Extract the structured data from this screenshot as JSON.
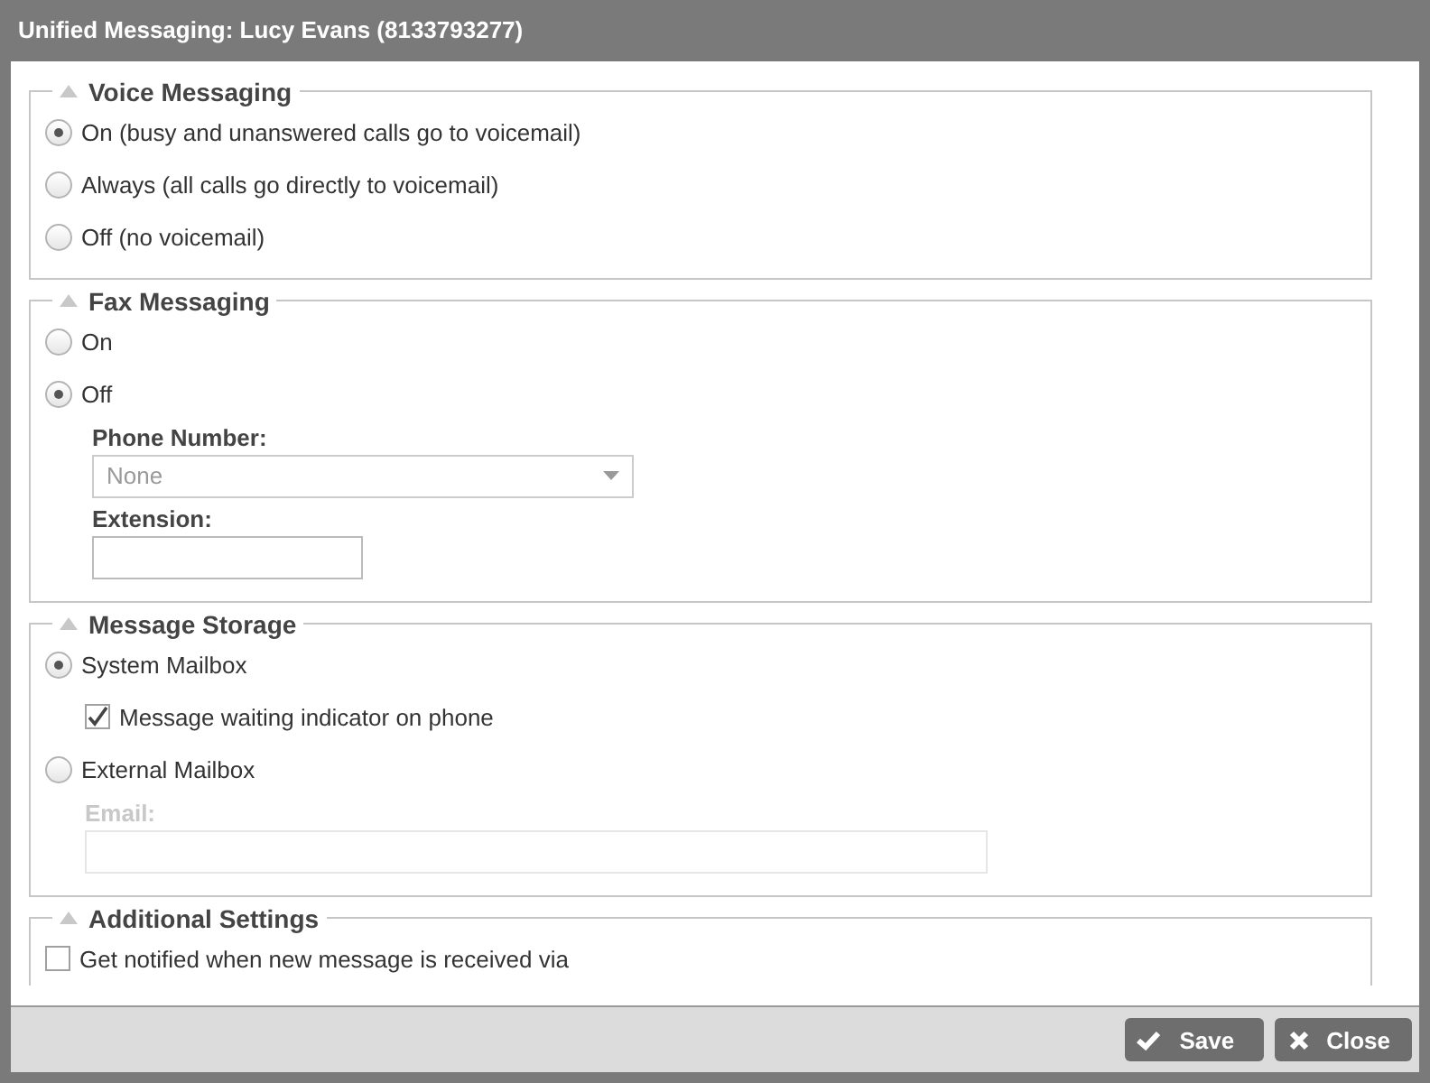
{
  "window": {
    "title": "Unified Messaging: Lucy Evans (8133793277)"
  },
  "sections": [
    {
      "title": "Voice Messaging",
      "expanded": true,
      "items": [
        {
          "kind": "radio",
          "label": "On (busy and unanswered calls go to voicemail)",
          "selected": true
        },
        {
          "kind": "radio",
          "label": "Always (all calls go directly to voicemail)",
          "selected": false
        },
        {
          "kind": "radio",
          "label": "Off (no voicemail)",
          "selected": false
        }
      ]
    },
    {
      "title": "Fax Messaging",
      "expanded": true,
      "items": [
        {
          "kind": "radio",
          "label": "On",
          "selected": false
        },
        {
          "kind": "radio",
          "label": "Off",
          "selected": true
        },
        {
          "kind": "select",
          "label": "Phone Number:",
          "value": "None",
          "disabled": true
        },
        {
          "kind": "text",
          "label": "Extension:",
          "disabled": false
        }
      ]
    },
    {
      "title": "Message Storage",
      "expanded": true,
      "items": [
        {
          "kind": "radio",
          "label": "System Mailbox",
          "selected": true
        },
        {
          "kind": "checkbox",
          "label": "Message waiting indicator on phone",
          "checked": true
        },
        {
          "kind": "radio",
          "label": "External Mailbox",
          "selected": false
        },
        {
          "kind": "wide-text",
          "label": "Email:",
          "disabled": true
        }
      ]
    },
    {
      "title": "Additional Settings",
      "expanded": true,
      "items": [
        {
          "kind": "checkbox-plain",
          "label": "Get notified when new message is received via",
          "checked": false
        }
      ]
    }
  ],
  "buttons": [
    {
      "kind": "save",
      "label": "Save"
    },
    {
      "kind": "close",
      "label": "Close"
    }
  ]
}
